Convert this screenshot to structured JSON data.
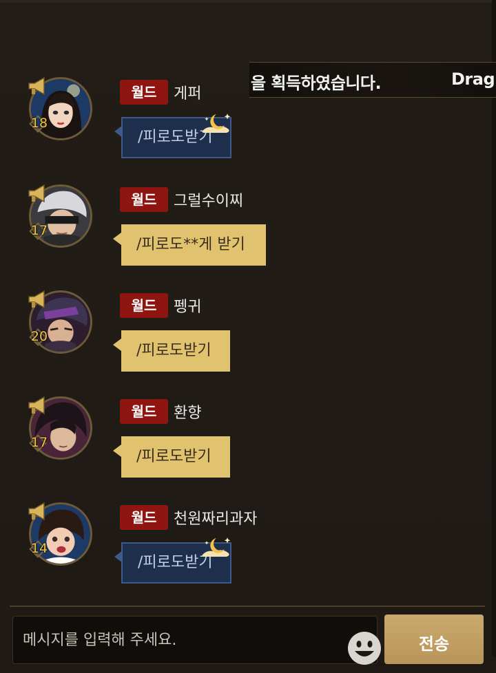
{
  "ticker": {
    "text": "을 획득하였습니다.",
    "text2": "Drag"
  },
  "messages": [
    {
      "level": "18",
      "channel": "월드",
      "nickname": "게퍼",
      "text": "/피로도받기",
      "style": "blue"
    },
    {
      "level": "17",
      "channel": "월드",
      "nickname": "그럴수이찌",
      "text": "/피로도**게 받기",
      "style": "gold"
    },
    {
      "level": "20",
      "channel": "월드",
      "nickname": "펭귀",
      "text": "/피로도받기",
      "style": "gold"
    },
    {
      "level": "17",
      "channel": "월드",
      "nickname": "환향",
      "text": "/피로도받기",
      "style": "gold"
    },
    {
      "level": "14",
      "channel": "월드",
      "nickname": "천원짜리과자",
      "text": "/피로도받기",
      "style": "blue"
    }
  ],
  "input": {
    "placeholder": "메시지를 입력해 주세요."
  },
  "send": {
    "label": "전송"
  },
  "icons": {
    "megaphone": "megaphone-icon",
    "moon": "moon-icon",
    "emoji": "smiley-icon"
  },
  "colors": {
    "badge": "#8f1510",
    "level": "#f5c542",
    "bubble_gold": "#e1c26f",
    "bubble_blue": "#1e2f4e",
    "send_button": "#c9a96e"
  }
}
